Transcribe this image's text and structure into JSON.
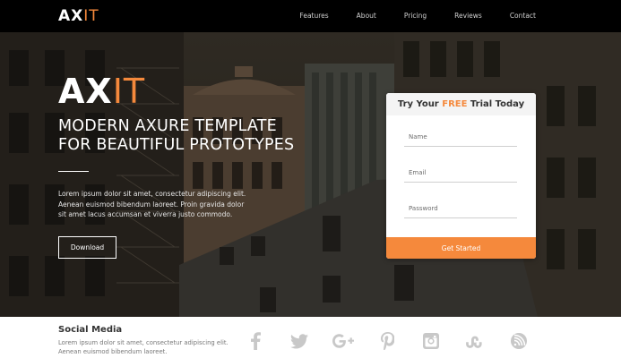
{
  "brand": {
    "prefix": "AX",
    "accent": "IT"
  },
  "nav": {
    "links": [
      "Features",
      "About",
      "Pricing",
      "Reviews",
      "Contact"
    ]
  },
  "hero": {
    "logo_prefix": "AX",
    "logo_accent": "IT",
    "headline_line1": "MODERN AXURE TEMPLATE",
    "headline_line2": "FOR BEAUTIFUL PROTOTYPES",
    "description": "Lorem ipsum dolor sit amet, consectetur adipiscing elit. Aenean euismod bibendum laoreet. Proin gravida dolor sit amet lacus accumsan et viverra justo commodo.",
    "download_label": "Download"
  },
  "signup": {
    "title_prefix": "Try Your",
    "title_highlight": "FREE",
    "title_suffix": "Trial Today",
    "name_placeholder": "Name",
    "email_placeholder": "Email",
    "password_placeholder": "Password",
    "submit_label": "Get Started"
  },
  "footer": {
    "title": "Social Media",
    "text": "Lorem ipsum dolor sit amet, consectetur adipiscing elit. Aenean euismod bibendum laoreet.",
    "icons": [
      "facebook-icon",
      "twitter-icon",
      "google-plus-icon",
      "pinterest-icon",
      "instagram-icon",
      "stumbleupon-icon",
      "rss-icon"
    ]
  },
  "colors": {
    "accent": "#f5893c",
    "nav_bg": "#000000",
    "icon_gray": "#c8c8c8"
  }
}
